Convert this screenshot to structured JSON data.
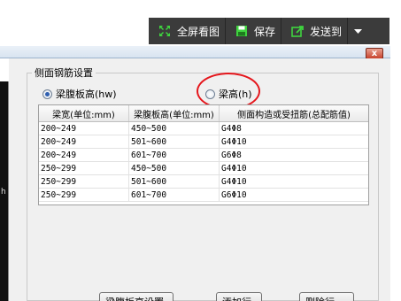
{
  "toolbar": {
    "fullscreen_label": "全屏看图",
    "save_label": "保存",
    "send_label": "发送到",
    "colors": {
      "bg": "#3b3b3b",
      "icon_green": "#3fd43f"
    }
  },
  "dialog": {
    "close_glyph": "x",
    "group_title": "侧面钢筋设置",
    "radio_web_height": "梁腹板高(hw)",
    "radio_beam_height": "梁高(h)",
    "side_mark": "h"
  },
  "table": {
    "headers": [
      "梁宽(单位:mm)",
      "梁腹板高(单位:mm)",
      "侧面构造或受扭筋(总配筋值)"
    ],
    "rows": [
      [
        "200~249",
        "450~500",
        "G4Φ8"
      ],
      [
        "200~249",
        "501~600",
        "G4Φ10"
      ],
      [
        "200~249",
        "601~700",
        "G6Φ8"
      ],
      [
        "250~299",
        "450~500",
        "G4Φ10"
      ],
      [
        "250~299",
        "501~600",
        "G4Φ10"
      ],
      [
        "250~299",
        "601~700",
        "G6Φ10"
      ]
    ]
  },
  "buttons": {
    "web_height_settings": "梁腹板高设置",
    "add_row": "添加行",
    "delete_row": "删除行"
  }
}
